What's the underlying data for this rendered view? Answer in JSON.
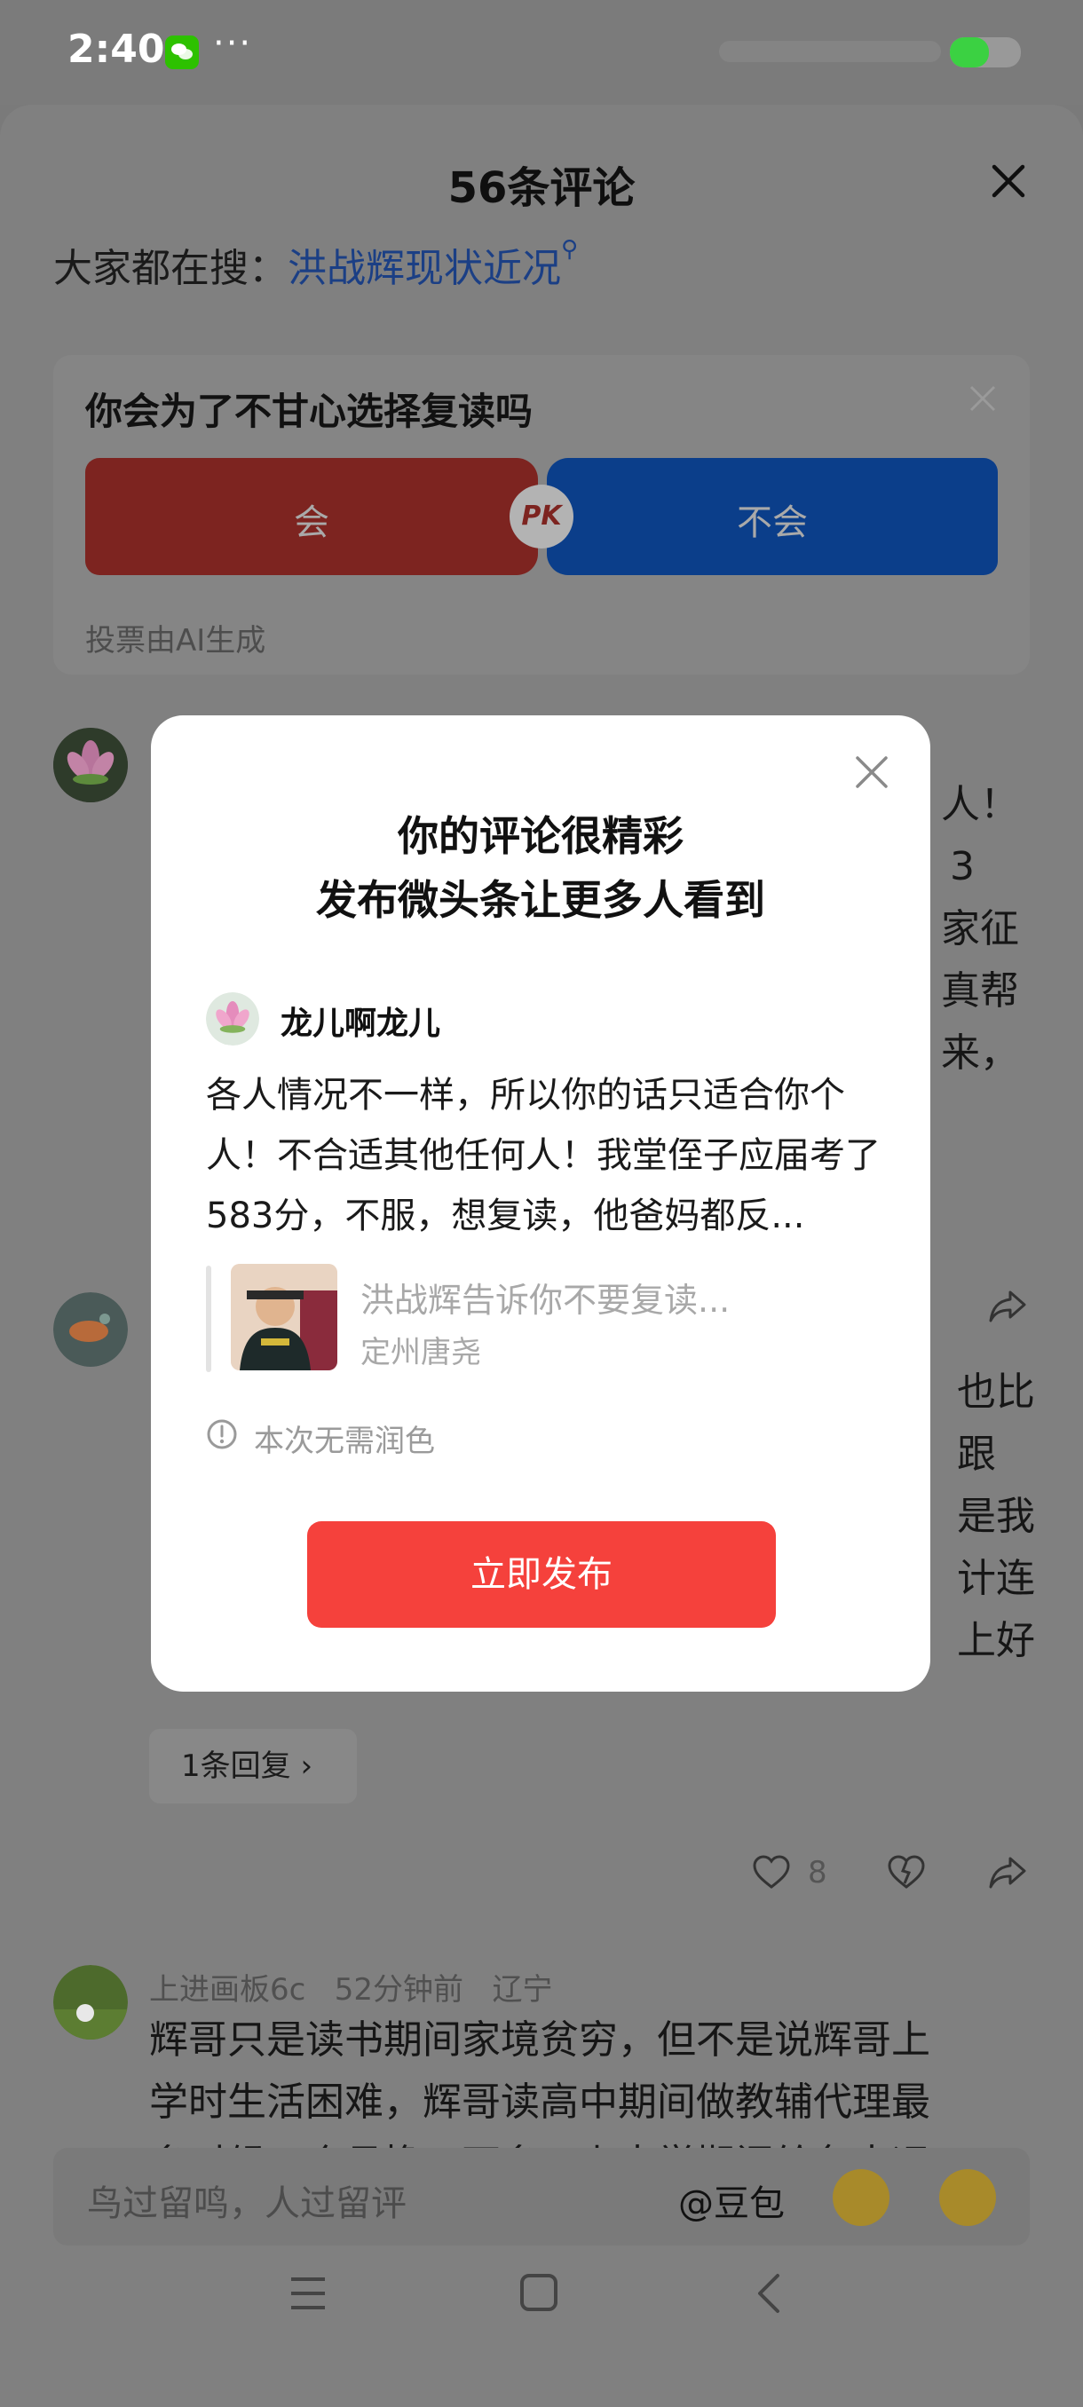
{
  "status_bar": {
    "time": "2:40",
    "app_icon": "wechat-icon",
    "more": "···",
    "battery_level": 0.55,
    "battery_color": "#3bd142"
  },
  "sheet": {
    "title": "56条评论",
    "search_label": "大家都在搜：",
    "search_keyword": "洪战辉现状近况",
    "search_icon": "search-icon"
  },
  "vote": {
    "question": "你会为了不甘心选择复读吗",
    "option_yes": "会",
    "option_no": "不会",
    "pk": "PK",
    "note": "投票由AI生成"
  },
  "comments": [
    {
      "visible_tail": [
        "人！",
        "3",
        "家征",
        "真帮",
        "来，"
      ]
    },
    {
      "visible_tail": [
        "也比",
        "跟",
        "是我",
        "计连",
        "上好"
      ],
      "reply_label": "1条回复 ›",
      "likes": "8"
    },
    {
      "user": "上进画板6c",
      "time": "52分钟前",
      "location": "辽宁",
      "lines": [
        "辉哥只是读书期间家境贫穷，但不是说辉哥上",
        "学时生活困难，辉哥读高中期间做教辅代理最",
        "多时候一个月挣一万多，上大学期间给各大运"
      ]
    }
  ],
  "input": {
    "placeholder": "鸟过留鸣，人过留评",
    "mention": "@豆包",
    "emojis": [
      "crying-face-icon",
      "tired-face-icon"
    ]
  },
  "modal": {
    "title_line1": "你的评论很精彩",
    "title_line2": "发布微头条让更多人看到",
    "username": "龙儿啊龙儿",
    "body": "各人情况不一样，所以你的话只适合你个人！不合适其他任何人！我堂侄子应届考了583分，不服，想复读，他爸妈都反...",
    "video_title": "洪战辉告诉你不要复读...",
    "video_author": "定州唐尧",
    "info": "本次无需润色",
    "publish_button": "立即发布"
  },
  "colors": {
    "accent_red": "#f5413c",
    "link_blue": "#1b3f85"
  }
}
